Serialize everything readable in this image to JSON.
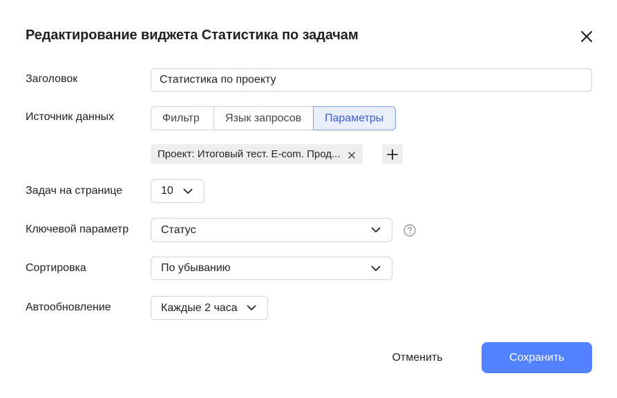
{
  "dialog": {
    "title": "Редактирование виджета Статистика по задачам"
  },
  "fields": {
    "title_label": "Заголовок",
    "title_value": "Статистика по проекту",
    "source_label": "Источник данных",
    "source_tabs": [
      "Фильтр",
      "Язык запросов",
      "Параметры"
    ],
    "source_active": "Параметры",
    "filter_chip": "Проект: Итоговый тест. E-com. Прод...",
    "per_page_label": "Задач на странице",
    "per_page_value": "10",
    "key_param_label": "Ключевой параметр",
    "key_param_value": "Статус",
    "sort_label": "Сортировка",
    "sort_value": "По убыванию",
    "refresh_label": "Автообновление",
    "refresh_value": "Каждые 2 часа"
  },
  "actions": {
    "cancel": "Отменить",
    "save": "Сохранить"
  },
  "colors": {
    "accent": "#5282ff",
    "active_tab_bg": "#e8eefc",
    "chip_bg": "#eeeeef"
  }
}
